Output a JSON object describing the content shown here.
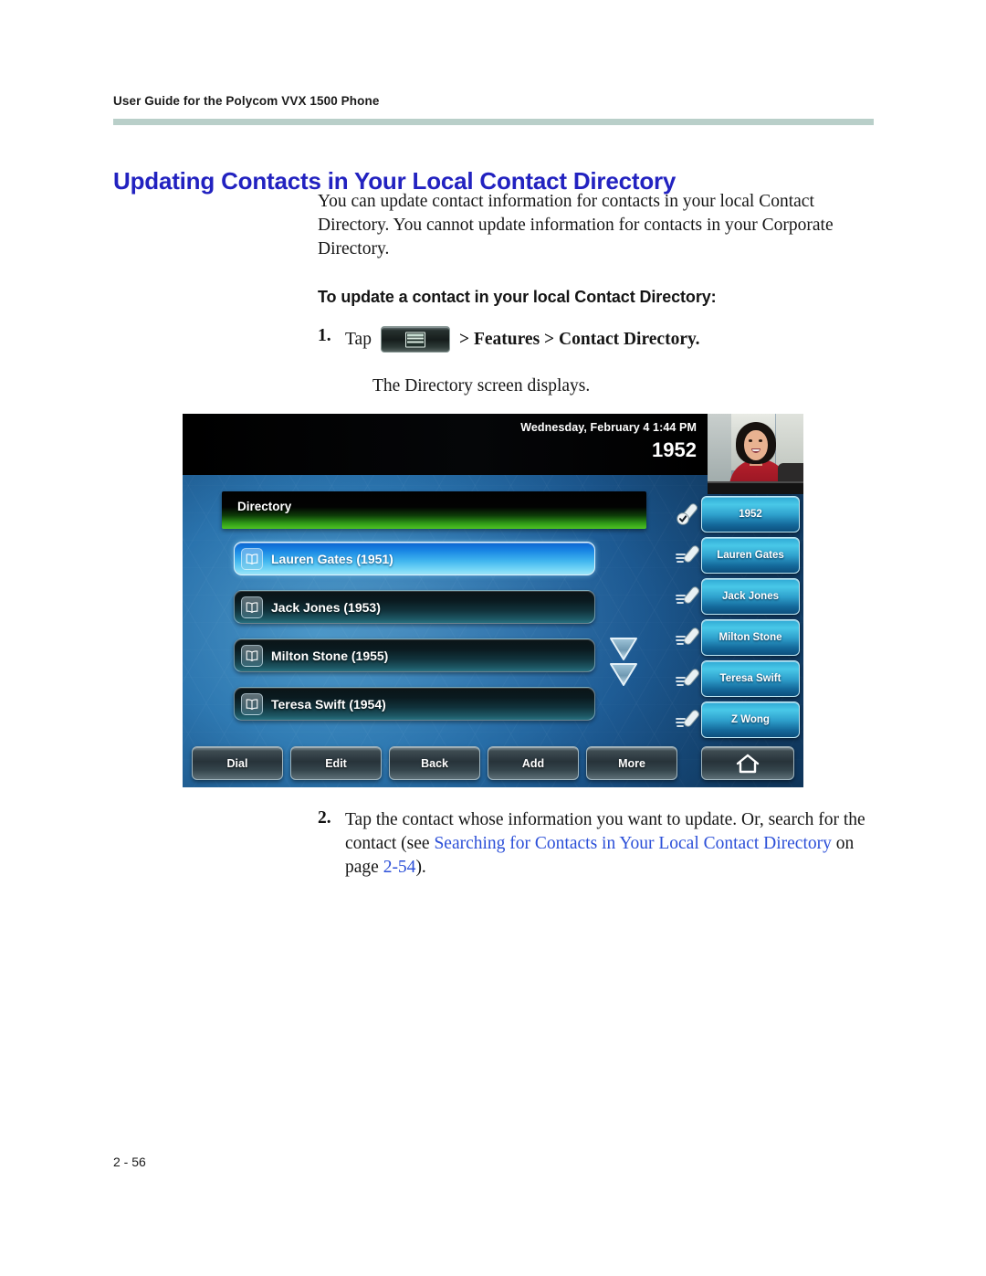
{
  "document": {
    "running_header": "User Guide for the Polycom VVX 1500 Phone",
    "title": "Updating Contacts in Your Local Contact Directory",
    "intro": "You can update contact information for contacts in your local Contact Directory. You cannot update information for contacts in your Corporate Directory.",
    "subheading": "To update a contact in your local Contact Directory:",
    "footer_page": "2 - 56",
    "title_color": "#2222c0",
    "link_color": "#2b4fd8",
    "rule_color": "#b9cfc9"
  },
  "steps": [
    {
      "number": "1.",
      "tap_label": "Tap",
      "menu_icon": "menu-window-icon",
      "path_text": "> Features > Contact Directory.",
      "result_text": "The Directory screen displays."
    },
    {
      "number": "2.",
      "text_before": "Tap the contact whose information you want to update. Or, search for the contact (see ",
      "link_text": "Searching for Contacts in Your Local Contact Directory",
      "text_middle": " on page ",
      "link_page": "2-54",
      "text_after": ")."
    }
  ],
  "phone_screen": {
    "status": {
      "date_time": "Wednesday, February 4  1:44 PM",
      "extension": "1952"
    },
    "video_thumbnail": "video-self-view",
    "directory": {
      "title": "Directory",
      "contacts": [
        {
          "name": "Lauren Gates (1951)",
          "selected": true,
          "icon": "contact-book-icon"
        },
        {
          "name": "Jack Jones (1953)",
          "selected": false,
          "icon": "contact-book-icon"
        },
        {
          "name": "Milton Stone (1955)",
          "selected": false,
          "icon": "contact-book-icon"
        },
        {
          "name": "Teresa Swift (1954)",
          "selected": false,
          "icon": "contact-book-icon"
        }
      ],
      "scroll_indicators": [
        "page-down-icon",
        "scroll-down-icon"
      ]
    },
    "line_keys": [
      {
        "label": "1952",
        "icon": "handset-registered-icon"
      },
      {
        "label": "Lauren Gates",
        "icon": "handset-speeddial-icon"
      },
      {
        "label": "Jack Jones",
        "icon": "handset-speeddial-icon"
      },
      {
        "label": "Milton Stone",
        "icon": "handset-speeddial-icon"
      },
      {
        "label": "Teresa Swift",
        "icon": "handset-speeddial-icon"
      },
      {
        "label": "Z Wong",
        "icon": "handset-speeddial-icon"
      }
    ],
    "soft_keys": [
      {
        "label": "Dial"
      },
      {
        "label": "Edit"
      },
      {
        "label": "Back"
      },
      {
        "label": "Add"
      },
      {
        "label": "More"
      }
    ],
    "home_key_icon": "home-icon"
  }
}
